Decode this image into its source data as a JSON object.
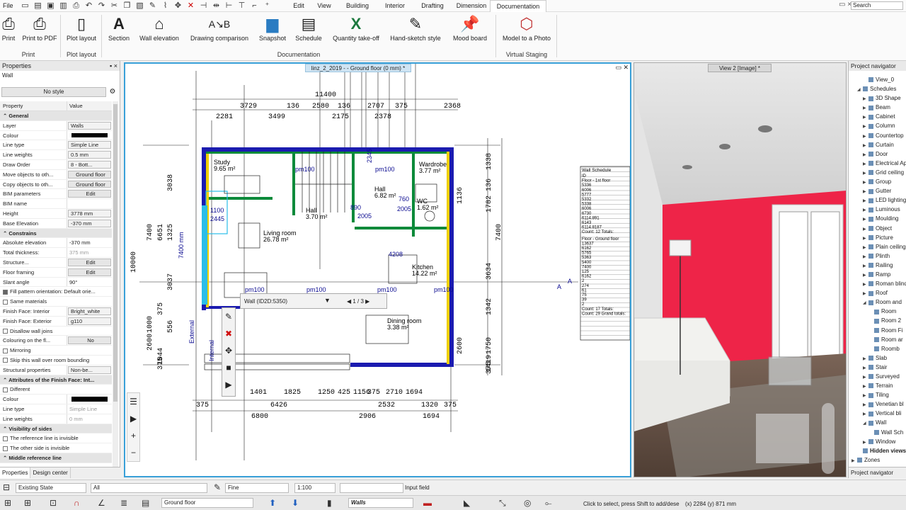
{
  "menubar": {
    "file": "File",
    "menus": [
      "Edit",
      "View",
      "Building",
      "Interior",
      "Drafting",
      "Dimension",
      "Documentation"
    ],
    "active_menu": "Documentation",
    "search_placeholder": "Search"
  },
  "ribbon": {
    "buttons": [
      {
        "label": "Print",
        "icon": "printer-icon"
      },
      {
        "label": "Print to PDF",
        "icon": "pdf-printer-icon"
      },
      {
        "label": "Plot layout",
        "icon": "plot-layout-icon"
      },
      {
        "label": "Section",
        "icon": "section-icon"
      },
      {
        "label": "Wall elevation",
        "icon": "wall-elevation-icon"
      },
      {
        "label": "Drawing comparison",
        "icon": "drawing-comparison-icon"
      },
      {
        "label": "Snapshot",
        "icon": "snapshot-icon"
      },
      {
        "label": "Schedule",
        "icon": "schedule-icon"
      },
      {
        "label": "Quantity take-off",
        "icon": "excel-icon"
      },
      {
        "label": "Hand-sketch style",
        "icon": "hand-sketch-icon"
      },
      {
        "label": "Mood board",
        "icon": "pin-icon"
      },
      {
        "label": "Model to a Photo",
        "icon": "cube-icon"
      }
    ],
    "groups": [
      "Print",
      "Plot layout",
      "Documentation",
      "Virtual Staging"
    ]
  },
  "properties": {
    "title": "Properties",
    "pin": "▪ ×",
    "type": "Wall",
    "style": "No style",
    "col_property": "Property",
    "col_value": "Value",
    "rows": [
      {
        "k": "General",
        "sec": true
      },
      {
        "k": "Layer",
        "v": "Walls",
        "kind": "box"
      },
      {
        "k": "Colour",
        "v": "",
        "kind": "black"
      },
      {
        "k": "Line type",
        "v": "Simple Line",
        "kind": "box"
      },
      {
        "k": "Line weights",
        "v": "0.5 mm",
        "kind": "box"
      },
      {
        "k": "Draw Order",
        "v": "8 - Bott...",
        "kind": "box"
      },
      {
        "k": "Move objects to oth...",
        "v": "Ground floor",
        "kind": "btn"
      },
      {
        "k": "Copy objects to oth...",
        "v": "Ground floor",
        "kind": "btn"
      },
      {
        "k": "BIM parameters",
        "v": "Edit",
        "kind": "btn"
      },
      {
        "k": "BIM name",
        "v": ""
      },
      {
        "k": "Height",
        "v": "3778 mm",
        "kind": "box"
      },
      {
        "k": "Base Elevation",
        "v": "-370 mm",
        "kind": "box"
      },
      {
        "k": "Constrains",
        "sec": true
      },
      {
        "k": "Absolute elevation",
        "v": "-370 mm"
      },
      {
        "k": "Total thickness:",
        "v": "375 mm",
        "kind": "grey"
      },
      {
        "k": "Structure...",
        "v": "Edit",
        "kind": "btn"
      },
      {
        "k": "Floor framing",
        "v": "Edit",
        "kind": "btn"
      },
      {
        "k": "Slant angle",
        "v": "90°"
      },
      {
        "k": "Fill pattern orientation: Default orie...",
        "chk": true,
        "on": true
      },
      {
        "k": "Same materials",
        "chk": true
      },
      {
        "k": "  Finish Face: Interior",
        "v": "Bright_white",
        "kind": "box"
      },
      {
        "k": "  Finish Face: Exterior",
        "v": "g110",
        "kind": "box"
      },
      {
        "k": "Disallow wall joins",
        "chk": true
      },
      {
        "k": "  Colouring on the fl...",
        "v": "No",
        "kind": "btn"
      },
      {
        "k": "Mirroring",
        "chk": true
      },
      {
        "k": "Skip this wall over room bounding",
        "chk": true
      },
      {
        "k": "Structural properties",
        "v": "Non-be...",
        "kind": "box"
      },
      {
        "k": "Attributes of the Finish Face: Int...",
        "sec": true
      },
      {
        "k": "Different",
        "chk": true
      },
      {
        "k": "Colour",
        "v": "",
        "kind": "black"
      },
      {
        "k": "Line type",
        "v": "Simple Line",
        "kind": "grey"
      },
      {
        "k": "Line weights",
        "v": "0 mm",
        "kind": "grey"
      },
      {
        "k": "Visibility of sides",
        "sec": true
      },
      {
        "k": "The reference line is invisible",
        "chk": true
      },
      {
        "k": "The other side is invisible",
        "chk": true
      },
      {
        "k": "Middle reference line",
        "sec": true
      }
    ],
    "tabs": [
      "Properties",
      "Design center"
    ]
  },
  "plan": {
    "title": "linz_2_2019 -  - Ground floor (0 mm) *",
    "wall_info": "Wall (ID2D:5350)",
    "wall_page": "1 / 3",
    "dims_top": [
      "11400",
      "3729",
      "136",
      "2580",
      "136",
      "2707",
      "375",
      "2368",
      "2281",
      "3499",
      "2175",
      "2378"
    ],
    "dims_bottom": [
      "1401",
      "1825",
      "1250",
      "425",
      "1156",
      "375",
      "2710",
      "1694",
      "375",
      "6426",
      "2532",
      "1320",
      "375",
      "6800",
      "2906",
      "1694"
    ],
    "dims_left": [
      "7400",
      "6651",
      "10000",
      "3038",
      "1325",
      "3037",
      "375",
      "2600",
      "1044",
      "1000",
      "556",
      "375"
    ],
    "dims_right": [
      "1338",
      "1782",
      "3634",
      "1342",
      "1750",
      "1419",
      "375",
      "136",
      "7400",
      "2600",
      "1136"
    ],
    "rooms": [
      {
        "name": "Study",
        "area": "9.65 m²"
      },
      {
        "name": "Hall",
        "area": "3.70 m²"
      },
      {
        "name": "Hall",
        "area": "6.82 m²"
      },
      {
        "name": "Wardrobe",
        "area": "3.77 m²"
      },
      {
        "name": "WC",
        "area": "1.62 m²"
      },
      {
        "name": "Living room",
        "area": "26.78 m²"
      },
      {
        "name": "Kitchen",
        "area": "14.22 m²"
      },
      {
        "name": "Dining room",
        "area": "3.38 m²"
      }
    ],
    "labels": [
      "pm100",
      "pm100",
      "pm100",
      "pm100",
      "pm100",
      "pm100",
      "2005",
      "2005",
      "890",
      "760",
      "4208",
      "2345",
      "2445",
      "1100",
      "7400 mm",
      "External",
      "Internal",
      "A",
      "A"
    ],
    "schedule_title": "Wall Schedule",
    "schedule_1": [
      "ID",
      "Floor - 1st floor",
      "5336",
      "6006",
      "5777",
      "5332",
      "5338",
      "6006",
      "6730",
      "6114.891",
      "6143",
      "6114.8187",
      "Count: 12 Totals:"
    ],
    "schedule_2": [
      "Floor - Ground floor",
      "13637",
      "6162",
      "5765",
      "5363",
      "5400",
      "7400",
      "125",
      "6162",
      "2",
      "274",
      "61",
      "75",
      "39",
      "2",
      "Count: 17 Totals:",
      "Count: 29 Grand totals:"
    ]
  },
  "view3d": {
    "title": "View 2 [Image] *",
    "accent_wall_color": "#ee2448"
  },
  "navigator": {
    "title": "Project navigator",
    "items": [
      {
        "t": "View_0",
        "d": 2
      },
      {
        "t": "Schedules",
        "d": 1,
        "exp": true
      },
      {
        "t": "3D Shape",
        "d": 2,
        "col": true
      },
      {
        "t": "Beam",
        "d": 2,
        "col": true
      },
      {
        "t": "Cabinet",
        "d": 2,
        "col": true
      },
      {
        "t": "Column",
        "d": 2,
        "col": true
      },
      {
        "t": "Countertop",
        "d": 2,
        "col": true
      },
      {
        "t": "Curtain",
        "d": 2,
        "col": true
      },
      {
        "t": "Door",
        "d": 2,
        "col": true
      },
      {
        "t": "Electrical App",
        "d": 2,
        "col": true
      },
      {
        "t": "Grid ceiling",
        "d": 2,
        "col": true
      },
      {
        "t": "Group",
        "d": 2,
        "col": true
      },
      {
        "t": "Gutter",
        "d": 2,
        "col": true
      },
      {
        "t": "LED lighting",
        "d": 2,
        "col": true
      },
      {
        "t": "Luminous",
        "d": 2,
        "col": true
      },
      {
        "t": "Moulding",
        "d": 2,
        "col": true
      },
      {
        "t": "Object",
        "d": 2,
        "col": true
      },
      {
        "t": "Picture",
        "d": 2,
        "col": true
      },
      {
        "t": "Plain ceiling",
        "d": 2,
        "col": true
      },
      {
        "t": "Plinth",
        "d": 2,
        "col": true
      },
      {
        "t": "Railing",
        "d": 2,
        "col": true
      },
      {
        "t": "Ramp",
        "d": 2,
        "col": true
      },
      {
        "t": "Roman blind",
        "d": 2,
        "col": true
      },
      {
        "t": "Roof",
        "d": 2,
        "col": true
      },
      {
        "t": "Room and",
        "d": 2,
        "exp": true
      },
      {
        "t": "Room",
        "d": 3
      },
      {
        "t": "Room 2",
        "d": 3
      },
      {
        "t": "Room Fi",
        "d": 3
      },
      {
        "t": "Room ar",
        "d": 3
      },
      {
        "t": "Roomb",
        "d": 3
      },
      {
        "t": "Slab",
        "d": 2,
        "col": true
      },
      {
        "t": "Stair",
        "d": 2,
        "col": true
      },
      {
        "t": "Surveyed",
        "d": 2,
        "col": true
      },
      {
        "t": "Terrain",
        "d": 2,
        "col": true
      },
      {
        "t": "Tiling",
        "d": 2,
        "col": true
      },
      {
        "t": "Venetian bl",
        "d": 2,
        "col": true
      },
      {
        "t": "Vertical bli",
        "d": 2,
        "col": true
      },
      {
        "t": "Wall",
        "d": 2,
        "exp": true
      },
      {
        "t": "Wall Sch",
        "d": 3
      },
      {
        "t": "Window",
        "d": 2,
        "col": true
      },
      {
        "t": "Hidden views",
        "d": 1,
        "bold": true
      },
      {
        "t": "Zones",
        "d": 0,
        "col": true
      }
    ],
    "tab": "Project navigator"
  },
  "status": {
    "state": "Existing State",
    "filter": "All",
    "linetype": "Fine",
    "scale": "1:100",
    "input_label": "Input field",
    "floor": "Ground floor",
    "layer": "Walls",
    "hint": "Click to select, press Shift to add/dese",
    "coords": "(x) 2284  (y) 871 mm"
  }
}
